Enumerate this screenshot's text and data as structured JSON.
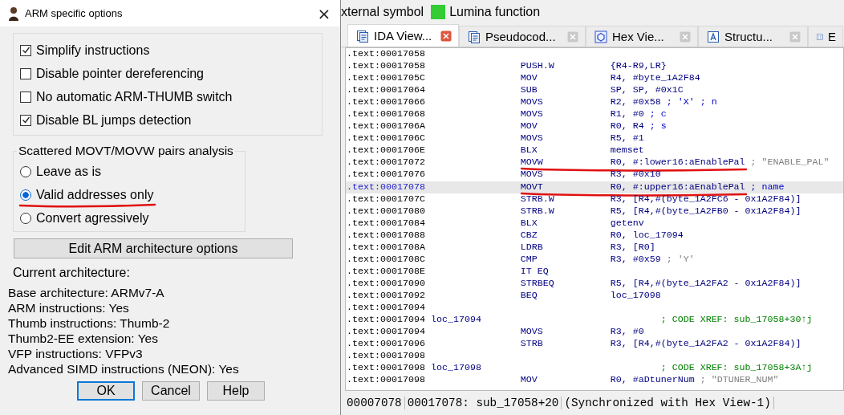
{
  "dialog": {
    "title": "ARM specific options",
    "close": "×",
    "checkboxes": [
      {
        "label": "Simplify instructions",
        "checked": true
      },
      {
        "label": "Disable pointer dereferencing",
        "checked": false
      },
      {
        "label": "No automatic ARM-THUMB switch",
        "checked": false
      },
      {
        "label": "Disable BL jumps detection",
        "checked": true
      }
    ],
    "radio_group": {
      "title": "Scattered MOVT/MOVW pairs analysis",
      "options": [
        {
          "label": "Leave as is",
          "selected": false,
          "underlined": false
        },
        {
          "label": "Valid addresses only",
          "selected": true,
          "underlined": true
        },
        {
          "label": "Convert agressively",
          "selected": false,
          "underlined": false
        }
      ]
    },
    "edit_button": "Edit ARM architecture options",
    "current_heading": "Current architecture:",
    "info_lines": [
      "Base architecture: ARMv7-A",
      "ARM instructions: Yes",
      "Thumb instructions: Thumb-2",
      "Thumb2-EE extension: Yes",
      "VFP instructions: VFPv3",
      "Advanced SIMD instructions (NEON): Yes"
    ],
    "buttons": [
      {
        "label": "OK",
        "default": true
      },
      {
        "label": "Cancel",
        "default": false
      },
      {
        "label": "Help",
        "default": false
      }
    ]
  },
  "legend": [
    {
      "label": "xternal symbol"
    },
    {
      "label": "Lumina function",
      "color": "#33cc33"
    }
  ],
  "tabs": [
    {
      "label": "IDA View...",
      "kind": "doc",
      "selected": true,
      "closable": true
    },
    {
      "label": "Pseudocod...",
      "kind": "doc",
      "selected": false,
      "closable": true
    },
    {
      "label": "Hex Vie...",
      "kind": "hex",
      "selected": false,
      "closable": true
    },
    {
      "label": "Structu...",
      "kind": "struct",
      "selected": false,
      "closable": true
    },
    {
      "label": "E",
      "kind": "list",
      "selected": false,
      "closable": false
    }
  ],
  "listing": [
    {
      "addr": ".text:00017058",
      "current": false,
      "underlined": false
    },
    {
      "addr": ".text:00017058",
      "mnem": "PUSH.W",
      "ops": "{R4-R9,LR}",
      "current": false,
      "underlined": false
    },
    {
      "addr": ".text:0001705C",
      "mnem": "MOV",
      "ops": "R4, #byte_1A2F84",
      "current": false,
      "underlined": false
    },
    {
      "addr": ".text:00017064",
      "mnem": "SUB",
      "ops": "SP, SP, #0x1C",
      "current": false,
      "underlined": false
    },
    {
      "addr": ".text:00017066",
      "mnem": "MOVS",
      "ops": "R2, #0x58",
      "comment": "; 'X' ; n",
      "kind": "plain",
      "current": false,
      "underlined": false
    },
    {
      "addr": ".text:00017068",
      "mnem": "MOVS",
      "ops": "R1, #0",
      "comment": "; c",
      "kind": "plain",
      "current": false,
      "underlined": false
    },
    {
      "addr": ".text:0001706A",
      "mnem": "MOV",
      "ops": "R0, R4",
      "comment": "; s",
      "kind": "plain",
      "current": false,
      "underlined": false
    },
    {
      "addr": ".text:0001706C",
      "mnem": "MOVS",
      "ops": "R5, #1",
      "current": false,
      "underlined": false
    },
    {
      "addr": ".text:0001706E",
      "mnem": "BLX",
      "ops": "memset",
      "current": false,
      "underlined": false
    },
    {
      "addr": ".text:00017072",
      "mnem": "MOVW",
      "ops": "R0, #:lower16:aEnablePal",
      "comment": "; \"ENABLE_PAL\"",
      "kind": "string",
      "current": false,
      "underlined": true
    },
    {
      "addr": ".text:00017076",
      "mnem": "MOVS",
      "ops": "R3, #0x10",
      "current": false,
      "underlined": false
    },
    {
      "addr": ".text:00017078",
      "mnem": "MOVT",
      "ops": "R0, #:upper16:aEnablePal",
      "comment": "; name",
      "kind": "plain",
      "current": true,
      "underlined": true
    },
    {
      "addr": ".text:0001707C",
      "mnem": "STRB.W",
      "ops": "R3, [R4,#(byte_1A2FC6 - 0x1A2F84)]",
      "current": false,
      "underlined": false
    },
    {
      "addr": ".text:00017080",
      "mnem": "STRB.W",
      "ops": "R5, [R4,#(byte_1A2FB0 - 0x1A2F84)]",
      "current": false,
      "underlined": false
    },
    {
      "addr": ".text:00017084",
      "mnem": "BLX",
      "ops": "getenv",
      "current": false,
      "underlined": false
    },
    {
      "addr": ".text:00017088",
      "mnem": "CBZ",
      "ops": "R0, loc_17094",
      "current": false,
      "underlined": false
    },
    {
      "addr": ".text:0001708A",
      "mnem": "LDRB",
      "ops": "R3, [R0]",
      "current": false,
      "underlined": false
    },
    {
      "addr": ".text:0001708C",
      "mnem": "CMP",
      "ops": "R3, #0x59",
      "comment": "; 'Y'",
      "kind": "string",
      "current": false,
      "underlined": false
    },
    {
      "addr": ".text:0001708E",
      "mnem": "IT EQ",
      "current": false,
      "underlined": false
    },
    {
      "addr": ".text:00017090",
      "mnem": "STRBEQ",
      "ops": "R5, [R4,#(byte_1A2FA2 - 0x1A2F84)]",
      "current": false,
      "underlined": false
    },
    {
      "addr": ".text:00017092",
      "mnem": "BEQ",
      "ops": "loc_17098",
      "current": false,
      "underlined": false
    },
    {
      "addr": ".text:00017094",
      "current": false,
      "underlined": false
    },
    {
      "addr": ".text:00017094",
      "label": "loc_17094",
      "comment": "; CODE XREF: sub_17058+30↑j",
      "kind": "xref",
      "current": false,
      "underlined": false
    },
    {
      "addr": ".text:00017094",
      "mnem": "MOVS",
      "ops": "R3, #0",
      "current": false,
      "underlined": false
    },
    {
      "addr": ".text:00017096",
      "mnem": "STRB",
      "ops": "R3, [R4,#(byte_1A2FA2 - 0x1A2F84)]",
      "current": false,
      "underlined": false
    },
    {
      "addr": ".text:00017098",
      "current": false,
      "underlined": false
    },
    {
      "addr": ".text:00017098",
      "label": "loc_17098",
      "comment": "; CODE XREF: sub_17058+3A↑j",
      "kind": "xref",
      "current": false,
      "underlined": false
    },
    {
      "addr": ".text:00017098",
      "mnem": "MOV",
      "ops": "R0, #aDtunerNum",
      "comment": "; \"DTUNER_NUM\"",
      "kind": "string",
      "current": false,
      "underlined": false
    }
  ],
  "status_bar": [
    "00007078",
    "00017078: sub_17058+20",
    "(Synchronized with Hex View-1)"
  ]
}
